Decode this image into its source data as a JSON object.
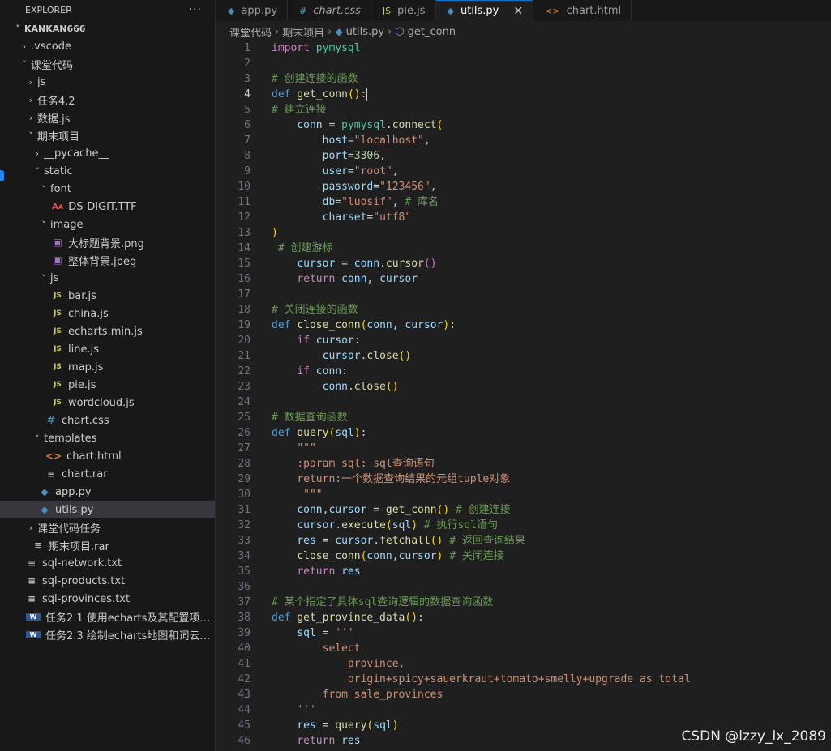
{
  "explorer": {
    "title": "EXPLORER",
    "more": "···",
    "tree": [
      {
        "label": "KANKAN666",
        "depth": 0,
        "type": "folder-open",
        "bold": true
      },
      {
        "label": ".vscode",
        "depth": 1,
        "type": "folder"
      },
      {
        "label": "课堂代码",
        "depth": 1,
        "type": "folder-open"
      },
      {
        "label": "js",
        "depth": 2,
        "type": "folder"
      },
      {
        "label": "任务4.2",
        "depth": 2,
        "type": "folder"
      },
      {
        "label": "数据.js",
        "depth": 2,
        "type": "folder"
      },
      {
        "label": "期末项目",
        "depth": 2,
        "type": "folder-open"
      },
      {
        "label": "__pycache__",
        "depth": 3,
        "type": "folder"
      },
      {
        "label": "static",
        "depth": 3,
        "type": "folder-open"
      },
      {
        "label": "font",
        "depth": 4,
        "type": "folder-open"
      },
      {
        "label": "DS-DIGIT.TTF",
        "depth": 5,
        "type": "font"
      },
      {
        "label": "image",
        "depth": 4,
        "type": "folder-open"
      },
      {
        "label": "大标题背景.png",
        "depth": 5,
        "type": "img"
      },
      {
        "label": "整体背景.jpeg",
        "depth": 5,
        "type": "img"
      },
      {
        "label": "js",
        "depth": 4,
        "type": "folder-open"
      },
      {
        "label": "bar.js",
        "depth": 5,
        "type": "js"
      },
      {
        "label": "china.js",
        "depth": 5,
        "type": "js"
      },
      {
        "label": "echarts.min.js",
        "depth": 5,
        "type": "js"
      },
      {
        "label": "line.js",
        "depth": 5,
        "type": "js"
      },
      {
        "label": "map.js",
        "depth": 5,
        "type": "js"
      },
      {
        "label": "pie.js",
        "depth": 5,
        "type": "js"
      },
      {
        "label": "wordcloud.js",
        "depth": 5,
        "type": "js"
      },
      {
        "label": "chart.css",
        "depth": 4,
        "type": "css"
      },
      {
        "label": "templates",
        "depth": 3,
        "type": "folder-open"
      },
      {
        "label": "chart.html",
        "depth": 4,
        "type": "html"
      },
      {
        "label": "chart.rar",
        "depth": 4,
        "type": "txt"
      },
      {
        "label": "app.py",
        "depth": 3,
        "type": "py"
      },
      {
        "label": "utils.py",
        "depth": 3,
        "type": "py",
        "selected": true
      },
      {
        "label": "课堂代码任务",
        "depth": 2,
        "type": "folder"
      },
      {
        "label": "期末项目.rar",
        "depth": 2,
        "type": "txt"
      },
      {
        "label": "sql-network.txt",
        "depth": 1,
        "type": "txt"
      },
      {
        "label": "sql-products.txt",
        "depth": 1,
        "type": "txt"
      },
      {
        "label": "sql-provinces.txt",
        "depth": 1,
        "type": "txt"
      },
      {
        "label": "任务2.1 使用echarts及其配置项绘图-...",
        "depth": 1,
        "type": "word"
      },
      {
        "label": "任务2.3 绘制echarts地图和词云图-学...",
        "depth": 1,
        "type": "word"
      }
    ]
  },
  "tabs": [
    {
      "label": "app.py",
      "icon": "py"
    },
    {
      "label": "chart.css",
      "icon": "css",
      "italic": true
    },
    {
      "label": "pie.js",
      "icon": "js"
    },
    {
      "label": "utils.py",
      "icon": "py",
      "active": true
    },
    {
      "label": "chart.html",
      "icon": "html"
    }
  ],
  "breadcrumb": [
    "课堂代码",
    "期末项目",
    "utils.py",
    "get_conn"
  ],
  "editor": {
    "current_line": 4,
    "lines": [
      [
        [
          "ctl",
          "import"
        ],
        [
          "",
          ""
        ],
        [
          "mod",
          " pymysql"
        ]
      ],
      [],
      [
        [
          "cmt",
          "# 创建连接的函数"
        ]
      ],
      [
        [
          "kw",
          "def"
        ],
        [
          "",
          " "
        ],
        [
          "fn",
          "get_conn"
        ],
        [
          "p1",
          "()"
        ],
        [
          "",
          ":"
        ],
        [
          "cursor",
          ""
        ]
      ],
      [
        [
          "cmt",
          "# 建立连接"
        ]
      ],
      [
        [
          "",
          "    "
        ],
        [
          "var",
          "conn"
        ],
        [
          "",
          " = "
        ],
        [
          "mod",
          "pymysql"
        ],
        [
          "",
          "."
        ],
        [
          "fn",
          "connect"
        ],
        [
          "p1",
          "("
        ]
      ],
      [
        [
          "",
          "        "
        ],
        [
          "var",
          "host"
        ],
        [
          "",
          "="
        ],
        [
          "str",
          "\"localhost\""
        ],
        [
          "",
          ","
        ]
      ],
      [
        [
          "",
          "        "
        ],
        [
          "var",
          "port"
        ],
        [
          "",
          "="
        ],
        [
          "num",
          "3306"
        ],
        [
          "",
          ","
        ]
      ],
      [
        [
          "",
          "        "
        ],
        [
          "var",
          "user"
        ],
        [
          "",
          "="
        ],
        [
          "str",
          "\"root\""
        ],
        [
          "",
          ","
        ]
      ],
      [
        [
          "",
          "        "
        ],
        [
          "var",
          "password"
        ],
        [
          "",
          "="
        ],
        [
          "str",
          "\"123456\""
        ],
        [
          "",
          ","
        ]
      ],
      [
        [
          "",
          "        "
        ],
        [
          "var",
          "db"
        ],
        [
          "",
          "="
        ],
        [
          "str",
          "\"luosif\""
        ],
        [
          "",
          ", "
        ],
        [
          "cmt",
          "# 库名"
        ]
      ],
      [
        [
          "",
          "        "
        ],
        [
          "var",
          "charset"
        ],
        [
          "",
          "="
        ],
        [
          "str",
          "\"utf8\""
        ]
      ],
      [
        [
          "p1",
          ")"
        ]
      ],
      [
        [
          "",
          " "
        ],
        [
          "cmt",
          "# 创建游标"
        ]
      ],
      [
        [
          "",
          "    "
        ],
        [
          "var",
          "cursor"
        ],
        [
          "",
          " = "
        ],
        [
          "var",
          "conn"
        ],
        [
          "",
          "."
        ],
        [
          "fn",
          "cursor"
        ],
        [
          "p2",
          "()"
        ]
      ],
      [
        [
          "",
          "    "
        ],
        [
          "ctl",
          "return"
        ],
        [
          "",
          " "
        ],
        [
          "var",
          "conn"
        ],
        [
          "",
          ", "
        ],
        [
          "var",
          "cursor"
        ]
      ],
      [],
      [
        [
          "cmt",
          "# 关闭连接的函数"
        ]
      ],
      [
        [
          "kw",
          "def"
        ],
        [
          "",
          " "
        ],
        [
          "fn",
          "close_conn"
        ],
        [
          "p1",
          "("
        ],
        [
          "var",
          "conn"
        ],
        [
          "",
          ", "
        ],
        [
          "var",
          "cursor"
        ],
        [
          "p1",
          ")"
        ],
        [
          "",
          ":"
        ]
      ],
      [
        [
          "",
          "    "
        ],
        [
          "ctl",
          "if"
        ],
        [
          "",
          " "
        ],
        [
          "var",
          "cursor"
        ],
        [
          "",
          ":"
        ]
      ],
      [
        [
          "",
          "        "
        ],
        [
          "var",
          "cursor"
        ],
        [
          "",
          "."
        ],
        [
          "fn",
          "close"
        ],
        [
          "p1",
          "()"
        ]
      ],
      [
        [
          "",
          "    "
        ],
        [
          "ctl",
          "if"
        ],
        [
          "",
          " "
        ],
        [
          "var",
          "conn"
        ],
        [
          "",
          ":"
        ]
      ],
      [
        [
          "",
          "        "
        ],
        [
          "var",
          "conn"
        ],
        [
          "",
          "."
        ],
        [
          "fn",
          "close"
        ],
        [
          "p1",
          "()"
        ]
      ],
      [],
      [
        [
          "cmt",
          "# 数据查询函数"
        ]
      ],
      [
        [
          "kw",
          "def"
        ],
        [
          "",
          " "
        ],
        [
          "fn",
          "query"
        ],
        [
          "p1",
          "("
        ],
        [
          "var",
          "sql"
        ],
        [
          "p1",
          ")"
        ],
        [
          "",
          ":"
        ]
      ],
      [
        [
          "",
          "    "
        ],
        [
          "str",
          "\"\"\""
        ]
      ],
      [
        [
          "",
          "    "
        ],
        [
          "str",
          ":param sql: sql查询语句"
        ]
      ],
      [
        [
          "",
          "    "
        ],
        [
          "str",
          "return:一个数据查询结果的元组tuple对象"
        ]
      ],
      [
        [
          "",
          "     "
        ],
        [
          "str",
          "\"\"\""
        ]
      ],
      [
        [
          "",
          "    "
        ],
        [
          "var",
          "conn"
        ],
        [
          "",
          ","
        ],
        [
          "var",
          "cursor"
        ],
        [
          "",
          " = "
        ],
        [
          "fn",
          "get_conn"
        ],
        [
          "p1",
          "()"
        ],
        [
          "",
          " "
        ],
        [
          "cmt",
          "# 创建连接"
        ]
      ],
      [
        [
          "",
          "    "
        ],
        [
          "var",
          "cursor"
        ],
        [
          "",
          "."
        ],
        [
          "fn",
          "execute"
        ],
        [
          "p1",
          "("
        ],
        [
          "var",
          "sql"
        ],
        [
          "p1",
          ")"
        ],
        [
          "",
          " "
        ],
        [
          "cmt",
          "# 执行sql语句"
        ]
      ],
      [
        [
          "",
          "    "
        ],
        [
          "var",
          "res"
        ],
        [
          "",
          " = "
        ],
        [
          "var",
          "cursor"
        ],
        [
          "",
          "."
        ],
        [
          "fn",
          "fetchall"
        ],
        [
          "p1",
          "()"
        ],
        [
          "",
          " "
        ],
        [
          "cmt",
          "# 返回查询结果"
        ]
      ],
      [
        [
          "",
          "    "
        ],
        [
          "fn",
          "close_conn"
        ],
        [
          "p1",
          "("
        ],
        [
          "var",
          "conn"
        ],
        [
          "",
          ","
        ],
        [
          "var",
          "cursor"
        ],
        [
          "p1",
          ")"
        ],
        [
          "",
          " "
        ],
        [
          "cmt",
          "# 关闭连接"
        ]
      ],
      [
        [
          "",
          "    "
        ],
        [
          "ctl",
          "return"
        ],
        [
          "",
          " "
        ],
        [
          "var",
          "res"
        ]
      ],
      [],
      [
        [
          "cmt",
          "# 某个指定了具体sql查询逻辑的数据查询函数"
        ]
      ],
      [
        [
          "kw",
          "def"
        ],
        [
          "",
          " "
        ],
        [
          "fn",
          "get_province_data"
        ],
        [
          "p1",
          "()"
        ],
        [
          "",
          ":"
        ]
      ],
      [
        [
          "",
          "    "
        ],
        [
          "var",
          "sql"
        ],
        [
          "",
          " = "
        ],
        [
          "str",
          "'''"
        ]
      ],
      [
        [
          "",
          "        "
        ],
        [
          "str",
          "select"
        ]
      ],
      [
        [
          "",
          "            "
        ],
        [
          "str",
          "province,"
        ]
      ],
      [
        [
          "",
          "            "
        ],
        [
          "str",
          "origin+spicy+sauerkraut+tomato+smelly+upgrade as total"
        ]
      ],
      [
        [
          "",
          "        "
        ],
        [
          "str",
          "from sale_provinces"
        ]
      ],
      [
        [
          "",
          "    "
        ],
        [
          "str",
          "'''"
        ]
      ],
      [
        [
          "",
          "    "
        ],
        [
          "var",
          "res"
        ],
        [
          "",
          " = "
        ],
        [
          "fn",
          "query"
        ],
        [
          "p1",
          "("
        ],
        [
          "var",
          "sql"
        ],
        [
          "p1",
          ")"
        ]
      ],
      [
        [
          "",
          "    "
        ],
        [
          "ctl",
          "return"
        ],
        [
          "",
          " "
        ],
        [
          "var",
          "res"
        ]
      ]
    ]
  },
  "watermark": "CSDN @lzzy_lx_2089"
}
